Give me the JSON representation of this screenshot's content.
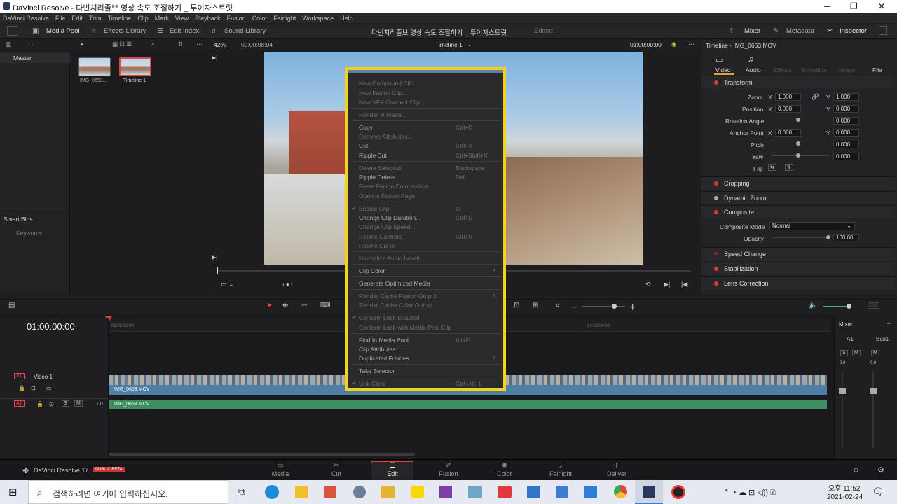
{
  "window": {
    "title": "DaVinci Resolve - 다빈치리졸브 영상 속도 조절하기 _ 투이자스트릿",
    "controls": [
      "─",
      "❐",
      "✕"
    ]
  },
  "menu": [
    "DaVinci Resolve",
    "File",
    "Edit",
    "Trim",
    "Timeline",
    "Clip",
    "Mark",
    "View",
    "Playback",
    "Fusion",
    "Color",
    "Fairlight",
    "Workspace",
    "Help"
  ],
  "toolbar": {
    "media_pool": "Media Pool",
    "effects_library": "Effects Library",
    "edit_index": "Edit Index",
    "sound_library": "Sound Library",
    "project_title": "다빈치리졸브 영상 속도 조절하기 _ 투이자스트릿",
    "edited": "Edited",
    "mixer": "Mixer",
    "metadata": "Metadata",
    "inspector": "Inspector"
  },
  "subbar": {
    "zoom": "42%",
    "timecode": "00:00:08:04",
    "timeline_name": "Timeline 1",
    "viewer_tc": "01:00:00:00",
    "inspector_title": "Timeline - IMG_0653.MOV"
  },
  "media_pool": {
    "bin_master": "Master",
    "smart_bins": "Smart Bins",
    "keywords": "Keywords",
    "clips": [
      "IMG_0653...",
      "Timeline 1"
    ]
  },
  "inspector": {
    "tabs": [
      "Video",
      "Audio",
      "Effects",
      "Transition",
      "Image",
      "File"
    ],
    "transform": "Transform",
    "rows": {
      "zoom": "Zoom",
      "zoom_x": "1.000",
      "zoom_y": "1.000",
      "position": "Position",
      "pos_x": "0.000",
      "pos_y": "0.000",
      "rotation": "Rotation Angle",
      "rotation_v": "0.000",
      "anchor": "Anchor Point",
      "anchor_x": "0.000",
      "anchor_y": "0.000",
      "pitch": "Pitch",
      "pitch_v": "0.000",
      "yaw": "Yaw",
      "yaw_v": "0.000",
      "flip": "Flip"
    },
    "cropping": "Cropping",
    "dynamic_zoom": "Dynamic Zoom",
    "composite": "Composite",
    "composite_mode_label": "Composite Mode",
    "composite_mode": "Normal",
    "opacity_label": "Opacity",
    "opacity": "100.00",
    "speed_change": "Speed Change",
    "stabilization": "Stabilization",
    "lens_correction": "Lens Correction",
    "x": "X",
    "y": "Y"
  },
  "timeline": {
    "timecode": "01:00:00:00",
    "ruler_start": "01:00:00:00",
    "ruler_mid": "01:00:04:00",
    "video_track_id": "V1",
    "video_track_name": "Video 1",
    "audio_track_id": "A1",
    "audio_level": "1.0",
    "clip_name_video": "IMG_0653.MOV",
    "clip_name_audio": "IMG_0653.MOV"
  },
  "mixer": {
    "title": "Mixer",
    "ch1": "A1",
    "ch2": "Bus1",
    "s": "S",
    "m": "M",
    "level": "0.0"
  },
  "context_menu": {
    "items": [
      {
        "label": "New Compound Clip...",
        "shortcut": ""
      },
      {
        "label": "New Fusion Clip...",
        "shortcut": ""
      },
      {
        "label": "New VFX Connect Clip...",
        "shortcut": ""
      },
      {
        "label": "Render in Place...",
        "shortcut": ""
      },
      {
        "label": "Copy",
        "shortcut": "Ctrl+C"
      },
      {
        "label": "Remove Attributes...",
        "shortcut": ""
      },
      {
        "label": "Cut",
        "shortcut": "Ctrl+X"
      },
      {
        "label": "Ripple Cut",
        "shortcut": "Ctrl+Shift+X"
      },
      {
        "label": "Delete Selected",
        "shortcut": "Backspace"
      },
      {
        "label": "Ripple Delete",
        "shortcut": "Del"
      },
      {
        "label": "Reset Fusion Composition...",
        "shortcut": ""
      },
      {
        "label": "Open in Fusion Page",
        "shortcut": ""
      },
      {
        "label": "Enable Clip",
        "shortcut": "D"
      },
      {
        "label": "Change Clip Duration...",
        "shortcut": "Ctrl+D"
      },
      {
        "label": "Change Clip Speed...",
        "shortcut": ""
      },
      {
        "label": "Retime Controls",
        "shortcut": "Ctrl+R"
      },
      {
        "label": "Retime Curve",
        "shortcut": ""
      },
      {
        "label": "Normalize Audio Levels...",
        "shortcut": ""
      },
      {
        "label": "Clip Color",
        "shortcut": ""
      },
      {
        "label": "Generate Optimized Media",
        "shortcut": ""
      },
      {
        "label": "Render Cache Fusion Output",
        "shortcut": ""
      },
      {
        "label": "Render Cache Color Output",
        "shortcut": ""
      },
      {
        "label": "Conform Lock Enabled",
        "shortcut": ""
      },
      {
        "label": "Conform Lock with Media Pool Clip",
        "shortcut": ""
      },
      {
        "label": "Find In Media Pool",
        "shortcut": "Alt+F"
      },
      {
        "label": "Clip Attributes...",
        "shortcut": ""
      },
      {
        "label": "Duplicated Frames",
        "shortcut": ""
      },
      {
        "label": "Take Selector",
        "shortcut": ""
      },
      {
        "label": "Link Clips",
        "shortcut": "Ctrl+Alt+L"
      }
    ]
  },
  "pages": [
    "Media",
    "Cut",
    "Edit",
    "Fusion",
    "Color",
    "Fairlight",
    "Deliver"
  ],
  "brand": {
    "name": "DaVinci Resolve 17",
    "badge": "PUBLIC BETA"
  },
  "taskbar": {
    "search_placeholder": "검색하려면 여기에 입력하십시오.",
    "time": "오후 11:52",
    "date": "2021-02-24"
  },
  "colors": {
    "accent": "#f4d21b",
    "playhead": "#e43b3b",
    "video_clip": "#4f7fa5",
    "audio_clip": "#3f8e5f"
  }
}
